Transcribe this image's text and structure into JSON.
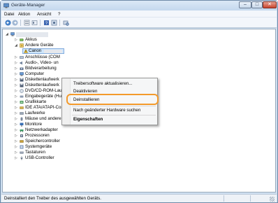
{
  "window": {
    "title": "Geräte-Manager"
  },
  "window_buttons": {
    "minimize": "–",
    "maximize": "□",
    "close": "✕"
  },
  "menu": [
    "Datei",
    "Aktion",
    "Ansicht",
    "?"
  ],
  "toolbar_icons": [
    "back-arrow-icon",
    "forward-arrow-icon",
    "properties-icon",
    "show-hidden-icon",
    "help-icon",
    "update-driver-icon",
    "scan-hardware-icon"
  ],
  "tree": {
    "root": "",
    "akkus": "Akkus",
    "andere_geraete": "Andere Geräte",
    "canon": "Canon",
    "anschluesse": "Anschlüsse (COM",
    "audio": "Audio-, Video- un",
    "bildverarbeitung": "Bildverarbeitung",
    "computer": "Computer",
    "diskettenlaufwerk1": "Diskettenlaufwerk",
    "diskettenlaufwerk2": "Diskettenlaufwerk",
    "dvd": "DVD/CD-ROM-Laufwerke",
    "eingabegeraete": "Eingabegeräte (Human Interface Devices)",
    "grafikkarte": "Grafikkarte",
    "ide": "IDE ATA/ATAPI-Controller",
    "laufwerke": "Laufwerke",
    "maeuse": "Mäuse und andere Zeigegeräte",
    "monitore": "Monitore",
    "netzwerkadapter": "Netzwerkadapter",
    "prozessoren": "Prozessoren",
    "speichercontroller": "Speichercontroller",
    "systemgeraete": "Systemgeräte",
    "tastaturen": "Tastaturen",
    "usb": "USB-Controller"
  },
  "context_menu": {
    "update": "Treibersoftware aktualisieren...",
    "disable": "Deaktivieren",
    "uninstall": "Deinstallieren",
    "scan": "Nach geänderter Hardware suchen",
    "properties": "Eigenschaften"
  },
  "status_bar": {
    "text": "Deinstalliert den Treiber des ausgewählten Geräts."
  },
  "colors": {
    "highlight": "#f39a2b",
    "titlebar": "#c4d8ee",
    "selection": "#cfe6fb"
  }
}
